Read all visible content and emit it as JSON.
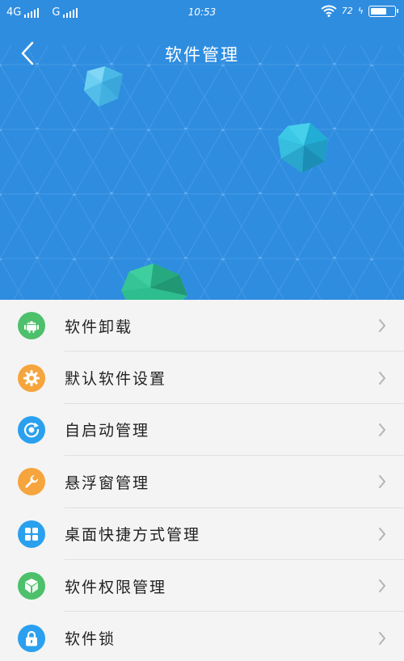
{
  "status_bar": {
    "network1": "4G",
    "network2": "G",
    "time": "10:53",
    "battery": "72",
    "battery_level": 0.72
  },
  "header": {
    "title": "软件管理"
  },
  "menu": {
    "items": [
      {
        "label": "软件卸载",
        "icon": "android-icon",
        "color": "#4cc06a"
      },
      {
        "label": "默认软件设置",
        "icon": "gear-icon",
        "color": "#f6a43c"
      },
      {
        "label": "自启动管理",
        "icon": "power-refresh-icon",
        "color": "#2aa0ee"
      },
      {
        "label": "悬浮窗管理",
        "icon": "wrench-icon",
        "color": "#f6a43c"
      },
      {
        "label": "桌面快捷方式管理",
        "icon": "grid-icon",
        "color": "#2aa0ee"
      },
      {
        "label": "软件权限管理",
        "icon": "shield-icon",
        "color": "#4cc06a"
      },
      {
        "label": "软件锁",
        "icon": "lock-icon",
        "color": "#2aa0ee"
      }
    ]
  },
  "colors": {
    "header_bg": "#2f8de0",
    "list_bg": "#f4f4f4"
  }
}
